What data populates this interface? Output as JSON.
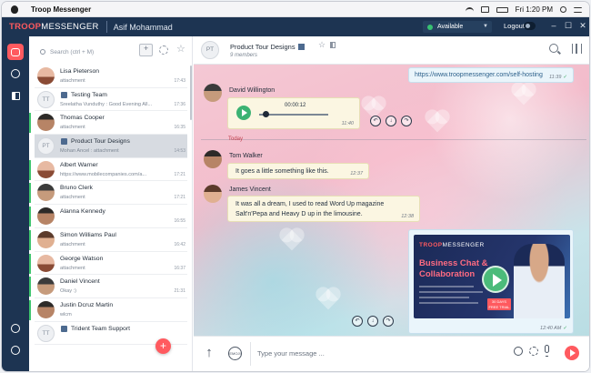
{
  "menubar": {
    "app_name": "Troop Messenger",
    "clock": "Fri 1:20 PM"
  },
  "titlebar": {
    "brand_left": "TROOP",
    "brand_right": "MESSENGER",
    "user_name": "Asif Mohammad",
    "status": "Available",
    "logout_label": "Logout"
  },
  "contacts": {
    "search_placeholder": "Search (ctrl + M)",
    "items": [
      {
        "name": "Lisa Pieterson",
        "preview": "attachment",
        "time": "17:43",
        "type": "user",
        "unread": false,
        "selected": false
      },
      {
        "name": "Testing Team",
        "preview": "Sreelatha Vunduthy : Good Evening All...",
        "time": "17:36",
        "type": "group",
        "avatar": "TT",
        "unread": false,
        "selected": false
      },
      {
        "name": "Thomas Cooper",
        "preview": "attachment",
        "time": "16:35",
        "type": "user",
        "unread": true,
        "selected": false
      },
      {
        "name": "Product Tour Designs",
        "preview": "Mohan Ancel : attachment",
        "time": "14:53",
        "type": "group",
        "avatar": "PT",
        "unread": false,
        "selected": true
      },
      {
        "name": "Albert Warner",
        "preview": "https://www.mobilecompanies.com/a...",
        "time": "17:21",
        "type": "user",
        "unread": true,
        "selected": false
      },
      {
        "name": "Bruno Clerk",
        "preview": "attachment",
        "time": "17:21",
        "type": "user",
        "unread": true,
        "selected": false
      },
      {
        "name": "Alanna Kennedy",
        "preview": "",
        "time": "16:55",
        "type": "user",
        "unread": true,
        "selected": false
      },
      {
        "name": "Simon Williams Paul",
        "preview": "attachment",
        "time": "16:42",
        "type": "user",
        "unread": true,
        "selected": false
      },
      {
        "name": "George Watson",
        "preview": "attachment",
        "time": "16:37",
        "type": "user",
        "unread": true,
        "selected": false
      },
      {
        "name": "Daniel Vincent",
        "preview": "Okay :)",
        "time": "21:31",
        "type": "user",
        "unread": true,
        "selected": false
      },
      {
        "name": "Justin Dcruz Martin",
        "preview": "wlcm",
        "time": "",
        "type": "user",
        "unread": true,
        "selected": false
      },
      {
        "name": "Trident Team Support",
        "preview": "",
        "time": "",
        "type": "group",
        "avatar": "TT",
        "unread": false,
        "selected": false
      }
    ]
  },
  "chat": {
    "avatar_initials": "PT",
    "title": "Product Tour Designs",
    "members": "9 members",
    "link_message": {
      "text": "https://www.troopmessenger.com/self-hosting",
      "time": "11:39"
    },
    "audio_message": {
      "sender": "David Willington",
      "duration": "00:00:12",
      "time": "11:40"
    },
    "day_separator": "Today",
    "text_message_1": {
      "sender": "Tom Walker",
      "text": "It goes a little something like this.",
      "time": "12:37"
    },
    "text_message_2": {
      "sender": "James Vincent",
      "line1": "It was all a dream, I used to read Word Up magazine",
      "line2": "Salt'n'Pepa and Heavy D up in the limousine.",
      "time": "12:38"
    },
    "video_message": {
      "brand_left": "TROOP",
      "brand_right": "MESSENGER",
      "headline1": "Business Chat &",
      "headline2": "Collaboration",
      "cta": "30 DAYS FREE TRIAL",
      "time": "12:40 AM"
    }
  },
  "composer": {
    "placeholder": "Type your message ...",
    "emoji_label": "EMOJI"
  },
  "colors": {
    "accent": "#ff5a5f",
    "navy": "#1d3452",
    "online": "#38c172"
  }
}
